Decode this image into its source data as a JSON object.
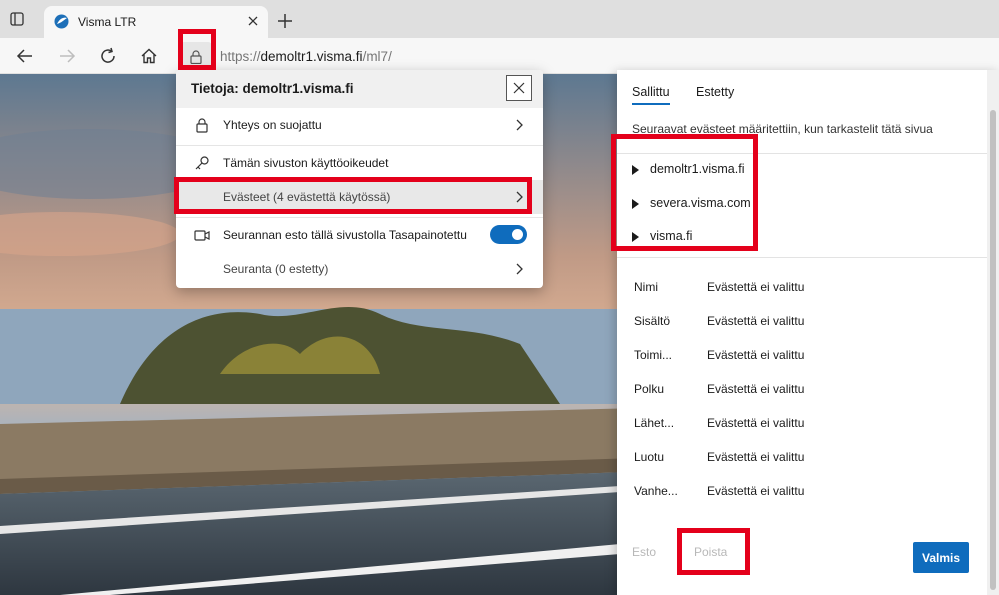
{
  "browser": {
    "tab_title": "Visma LTR",
    "url_scheme": "https://",
    "url_host": "demoltr1.visma.fi",
    "url_path": "/ml7/"
  },
  "site_info": {
    "title": "Tietoja: demoltr1.visma.fi",
    "items": [
      {
        "label": "Yhteys on suojattu"
      },
      {
        "label": "Tämän sivuston käyttöoikeudet"
      },
      {
        "label": "Evästeet (4 evästettä käytössä)"
      },
      {
        "label": "Seurannan esto tällä sivustolla Tasapainotettu",
        "toggle_on": true
      },
      {
        "label": "Seuranta (0 estetty)"
      }
    ]
  },
  "cookies_panel": {
    "tabs": [
      "Sallittu",
      "Estetty"
    ],
    "description": "Seuraavat evästeet määritettiin, kun tarkastelit tätä sivua",
    "domains": [
      "demoltr1.visma.fi",
      "severa.visma.com",
      "visma.fi"
    ],
    "properties": [
      {
        "key": "Nimi",
        "value": "Evästettä ei valittu"
      },
      {
        "key": "Sisältö",
        "value": "Evästettä ei valittu"
      },
      {
        "key": "Toimi...",
        "value": "Evästettä ei valittu"
      },
      {
        "key": "Polku",
        "value": "Evästettä ei valittu"
      },
      {
        "key": "Lähet...",
        "value": "Evästettä ei valittu"
      },
      {
        "key": "Luotu",
        "value": "Evästettä ei valittu"
      },
      {
        "key": "Vanhe...",
        "value": "Evästettä ei valittu"
      }
    ],
    "buttons": {
      "block": "Esto",
      "remove": "Poista",
      "done": "Valmis"
    }
  },
  "colors": {
    "accent": "#0f6cbd",
    "highlight": "#e4001b"
  }
}
